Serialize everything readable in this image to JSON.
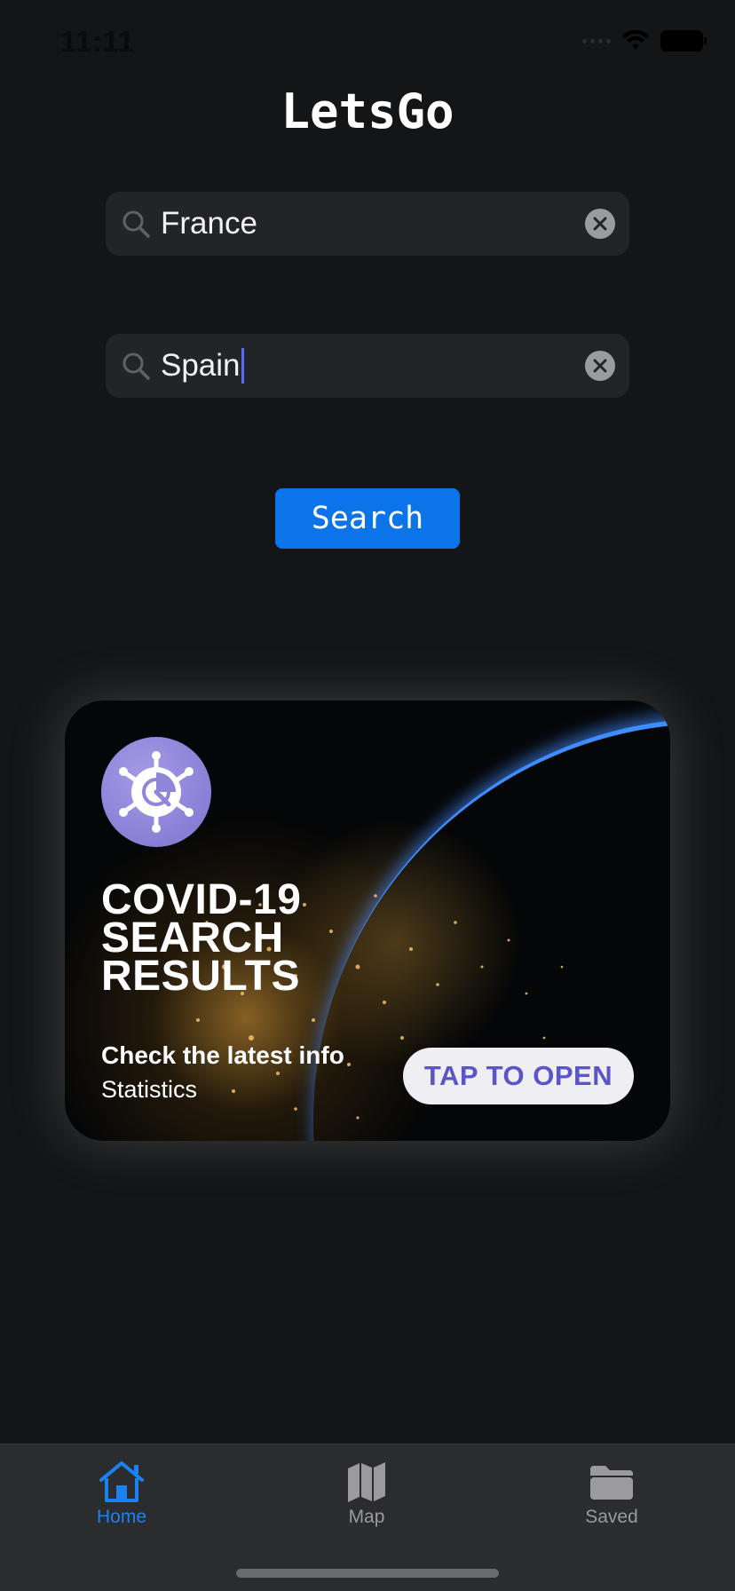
{
  "status_bar": {
    "time": "11:11"
  },
  "app": {
    "title": "LetsGo"
  },
  "search": {
    "origin_value": "France",
    "destination_value": "Spain",
    "button_label": "Search"
  },
  "banner": {
    "title_lines": [
      "COVID-19",
      "SEARCH",
      "RESULTS"
    ],
    "subtitle": "Check the latest info",
    "caption": "Statistics",
    "cta_label": "TAP TO OPEN"
  },
  "tab_bar": {
    "items": [
      {
        "label": "Home",
        "icon": "house-icon",
        "active": true
      },
      {
        "label": "Map",
        "icon": "map-icon",
        "active": false
      },
      {
        "label": "Saved",
        "icon": "folder-icon",
        "active": false
      }
    ]
  },
  "colors": {
    "background": "#131517",
    "field_bg": "#222427",
    "accent_blue": "#0a74e8",
    "tab_active": "#1a82f3",
    "tab_inactive": "#9b9b9f",
    "cta_text": "#5b55c8"
  }
}
